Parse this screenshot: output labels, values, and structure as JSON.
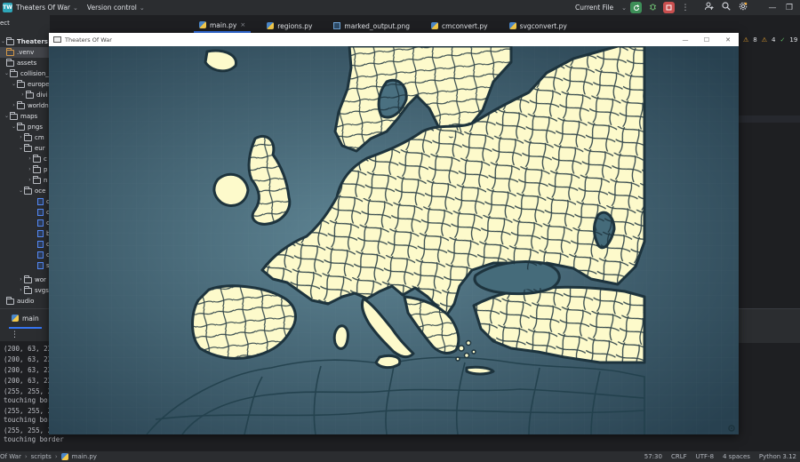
{
  "ide": {
    "project_badge": "TW",
    "project_name": "Theaters Of War",
    "vcs_label": "Version control",
    "run_config": "Current File"
  },
  "project_panel": {
    "header": "ect",
    "items": [
      {
        "label": "Theaters Of War"
      },
      {
        "label": ".venv"
      },
      {
        "label": "assets"
      },
      {
        "label": "collision_r"
      },
      {
        "label": "europe"
      },
      {
        "label": "divi"
      },
      {
        "label": "worldn"
      },
      {
        "label": "maps"
      },
      {
        "label": "pngs"
      },
      {
        "label": "cm"
      },
      {
        "label": "eur"
      },
      {
        "label": "c"
      },
      {
        "label": "p"
      },
      {
        "label": "n"
      },
      {
        "label": "oce"
      },
      {
        "label": "c"
      },
      {
        "label": "c"
      },
      {
        "label": "c"
      },
      {
        "label": "b"
      },
      {
        "label": "c"
      },
      {
        "label": "c"
      },
      {
        "label": "s"
      },
      {
        "label": "wor"
      },
      {
        "label": "svgs"
      },
      {
        "label": "audio"
      }
    ]
  },
  "editor_tabs": [
    {
      "label": "main.py",
      "icon": "python-file-icon",
      "closable": "×"
    },
    {
      "label": "regions.py",
      "icon": "python-file-icon"
    },
    {
      "label": "marked_output.png",
      "icon": "image-file-icon"
    },
    {
      "label": "cmconvert.py",
      "icon": "python-file-icon"
    },
    {
      "label": "svgconvert.py",
      "icon": "python-file-icon"
    }
  ],
  "inspections": {
    "warnings": "8",
    "weak_warnings": "4",
    "ok": "19"
  },
  "run_panel": {
    "tab_label": "main",
    "lines": [
      "(200, 63, 22",
      "(200, 63, 22",
      "(200, 63, 22",
      "(200, 63, 22",
      "(255, 255, 25",
      "touching bord",
      "(255, 255, 25",
      "touching bord",
      "(255, 255, 25",
      "touching border"
    ]
  },
  "statusbar": {
    "crumbs": [
      "Of War",
      "scripts",
      "main.py"
    ],
    "cursor": "57:30",
    "line_ending": "CRLF",
    "encoding": "UTF-8",
    "indent": "4 spaces",
    "interpreter": "Python 3.12"
  },
  "game_window": {
    "title": "Theaters Of War",
    "minimize": "—",
    "maximize": "☐",
    "close": "✕",
    "colors": {
      "land": "#fdfacb",
      "border": "#1d333d",
      "sea_center": "#5f8594",
      "sea_edge": "#284150"
    }
  }
}
